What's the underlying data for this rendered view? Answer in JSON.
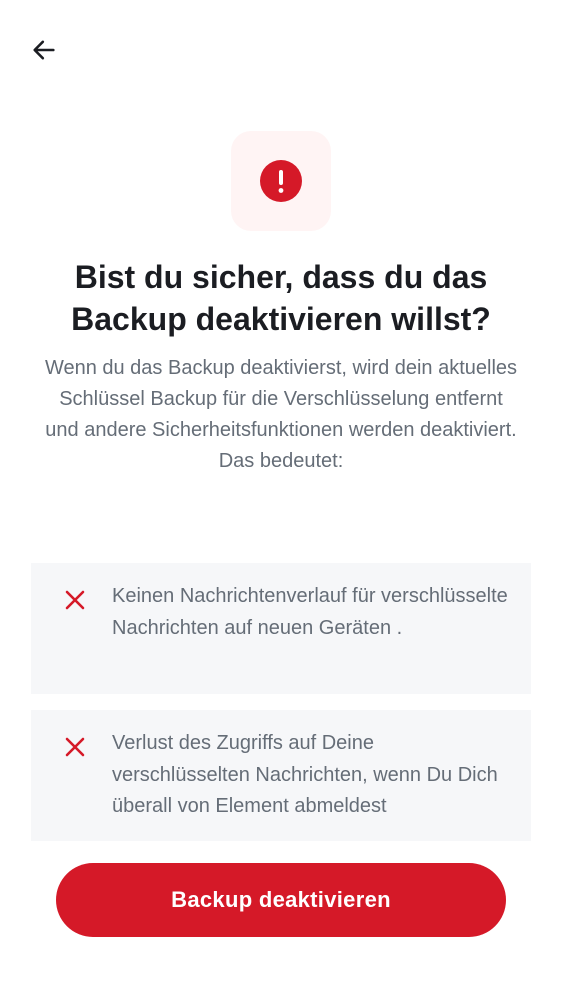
{
  "colors": {
    "accent": "#d51928",
    "icon_tile_bg": "#fff4f4",
    "card_bg": "#f6f7f9",
    "title_text": "#1b1d22",
    "body_text": "#656d77"
  },
  "header": {
    "back_icon": "arrow-left-icon"
  },
  "dialog": {
    "alert_icon": "exclamation-circle-icon",
    "alert_symbol": "!",
    "title": "Bist du sicher, dass du das Backup deaktivieren willst?",
    "description": "Wenn du das Backup deaktivierst, wird dein aktuelles Schlüssel Backup für die Verschlüsselung entfernt und andere Sicherheitsfunktionen werden deaktiviert. Das bedeutet:"
  },
  "consequences": [
    {
      "icon": "close-icon",
      "text": "Keinen Nachrichtenverlauf für verschlüsselte Nachrichten auf neuen Geräten ."
    },
    {
      "icon": "close-icon",
      "text": "Verlust des Zugriffs auf Deine verschlüsselten Nachrichten, wenn Du Dich überall von Element abmeldest"
    }
  ],
  "actions": {
    "confirm_label": "Backup deaktivieren"
  }
}
